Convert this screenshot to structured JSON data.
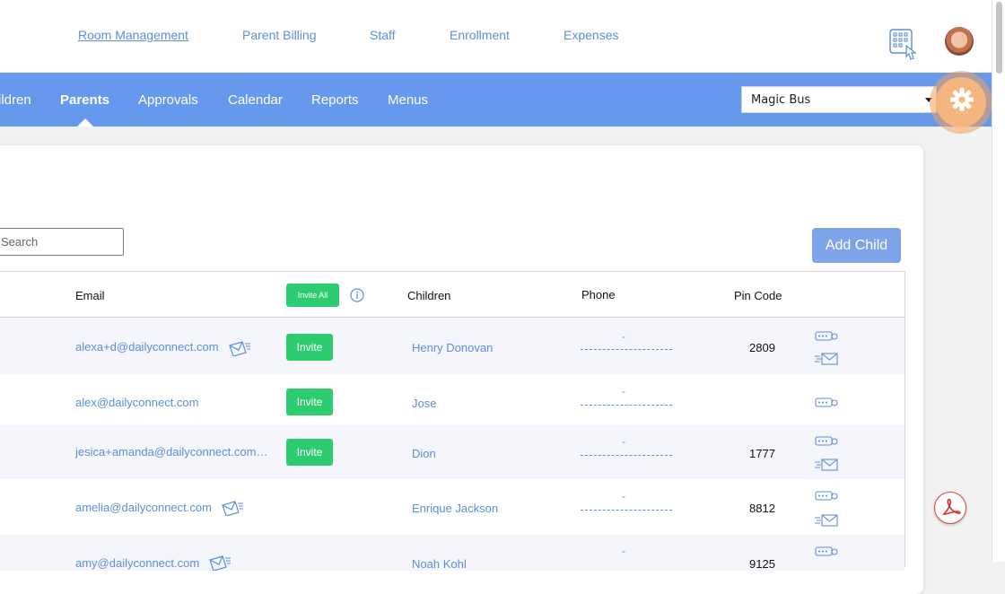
{
  "top_nav": {
    "links": [
      "Room Management",
      "Parent Billing",
      "Staff",
      "Enrollment",
      "Expenses"
    ]
  },
  "main_nav": {
    "tabs": [
      "ildren",
      "Parents",
      "Approvals",
      "Calendar",
      "Reports",
      "Menus"
    ],
    "active": "Parents"
  },
  "center_select": {
    "value": "Magic Bus"
  },
  "toolbar": {
    "search_placeholder": "Search",
    "add_child_label": "Add Child"
  },
  "table": {
    "headers": {
      "email": "Email",
      "invite_all": "Invite All",
      "children": "Children",
      "phone": "Phone",
      "pin": "Pin Code"
    },
    "rows": [
      {
        "email": "alexa+d@dailyconnect.com",
        "invite": "Invite",
        "child": "Henry Donovan",
        "phone": "-",
        "pin": "2809"
      },
      {
        "email": "alex@dailyconnect.com",
        "invite": "Invite",
        "child": "Jose",
        "phone": "-",
        "pin": ""
      },
      {
        "email": "jesica+amanda@dailyconnect.com…",
        "invite": "Invite",
        "child": "Dion",
        "phone": "-",
        "pin": "1777"
      },
      {
        "email": "amelia@dailyconnect.com",
        "invite": "",
        "child": "Enrique Jackson",
        "phone": "-",
        "pin": "8812"
      },
      {
        "email": "amy@dailyconnect.com",
        "invite": "",
        "child": "Noah Kohl",
        "phone": "-",
        "pin": "9125"
      }
    ]
  },
  "colors": {
    "accent": "#6699ee",
    "link": "#5b8fd8",
    "invite_green": "#2ecc71",
    "highlight": "#f4b57e"
  }
}
